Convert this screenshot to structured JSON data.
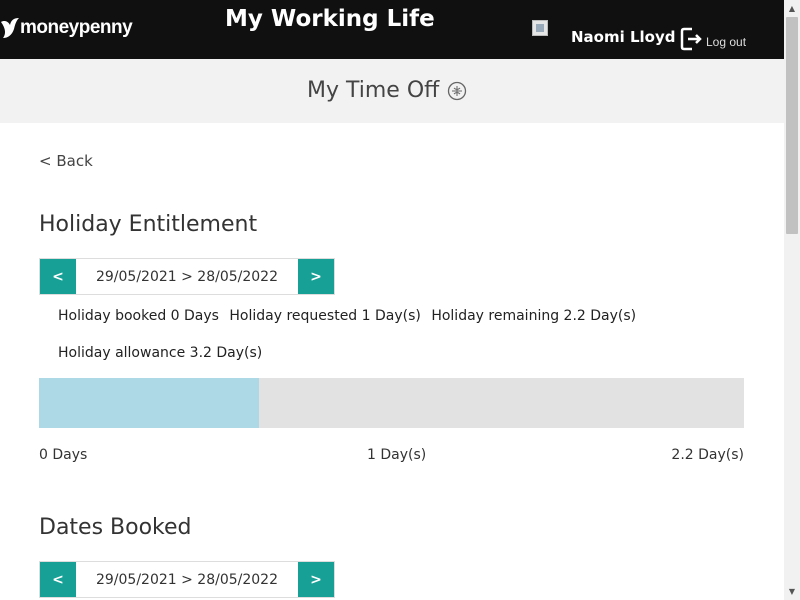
{
  "header": {
    "logo_text": "moneypenny",
    "app_title": "My Working Life",
    "user_name": "Naomi Lloyd",
    "logout_label": "Log out"
  },
  "subheader": {
    "title": "My Time Off",
    "icon": "globe-icon"
  },
  "back_label": "< Back",
  "entitlement": {
    "title": "Holiday Entitlement",
    "range": {
      "prev_label": "<",
      "text": "29/05/2021 > 28/05/2022",
      "next_label": ">"
    },
    "booked": "Holiday booked 0 Days",
    "requested": "Holiday requested 1 Day(s)",
    "remaining": "Holiday remaining 2.2 Day(s)",
    "allowance": "Holiday allowance 3.2 Day(s)",
    "progress": {
      "fill_fraction": 0.3125,
      "label_start": "0 Days",
      "label_mid": "1 Day(s)",
      "label_end": "2.2 Day(s)"
    }
  },
  "dates_booked": {
    "title": "Dates Booked",
    "range": {
      "prev_label": "<",
      "text": "29/05/2021 > 28/05/2022",
      "next_label": ">"
    }
  },
  "colors": {
    "accent": "#16a096",
    "header_bg": "#101010",
    "progress_fill": "#add8e6",
    "progress_track": "#e2e2e2"
  }
}
